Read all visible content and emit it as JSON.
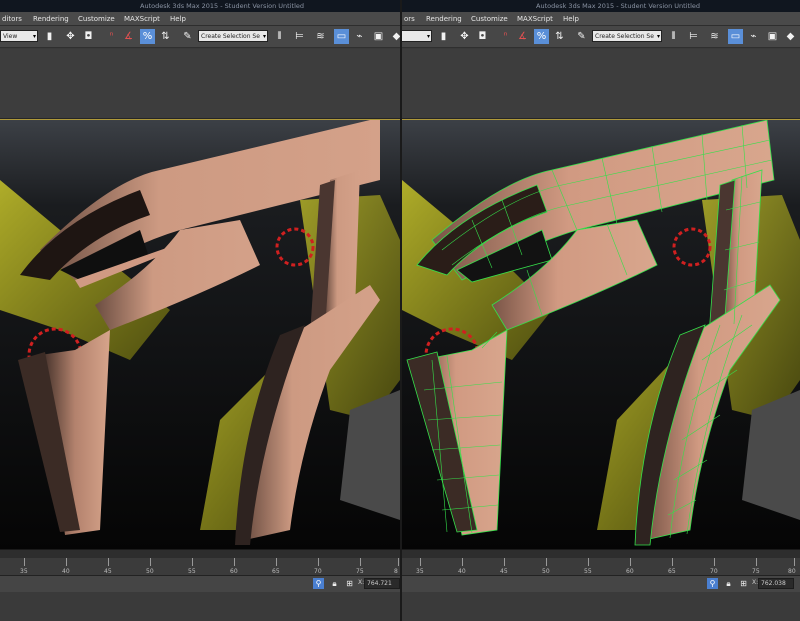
{
  "left": {
    "window_title": "Autodesk 3ds Max 2015 - Student Version   Untitled",
    "menu": [
      "ditors",
      "Rendering",
      "Customize",
      "MAXScript",
      "Help"
    ],
    "view_dropdown": "View",
    "selection_set": "Create Selection Se",
    "ruler_ticks": [
      "35",
      "40",
      "45",
      "50",
      "55",
      "60",
      "65",
      "70",
      "75",
      "8"
    ],
    "coord_label": "X:",
    "coord_value": "764.721"
  },
  "right": {
    "window_title": "Autodesk 3ds Max 2015 - Student Version   Untitled",
    "menu": [
      "ors",
      "Rendering",
      "Customize",
      "MAXScript",
      "Help"
    ],
    "view_dropdown": "",
    "selection_set": "Create Selection Se",
    "ruler_ticks": [
      "35",
      "40",
      "45",
      "50",
      "55",
      "60",
      "65",
      "70",
      "75",
      "80"
    ],
    "coord_label": "X:",
    "coord_value": "762.038"
  },
  "icons": [
    "select-link-icon",
    "move-icon",
    "rotate-icon",
    "snap-icon",
    "angle-snap-icon",
    "percent-snap-icon",
    "spinner-snap-icon",
    "edit-named-selection-icon",
    "mirror-icon",
    "align-icon",
    "layer-icon",
    "graphite-icon",
    "curve-editor-icon",
    "schematic-icon",
    "material-editor-icon",
    "lock-icon",
    "absolute-mode-icon"
  ],
  "colors": {
    "surface": "#d19a82",
    "wireframe": "#35e04a",
    "accent_yellow": "#b0b020",
    "selection_blue": "#4a7fd0"
  }
}
